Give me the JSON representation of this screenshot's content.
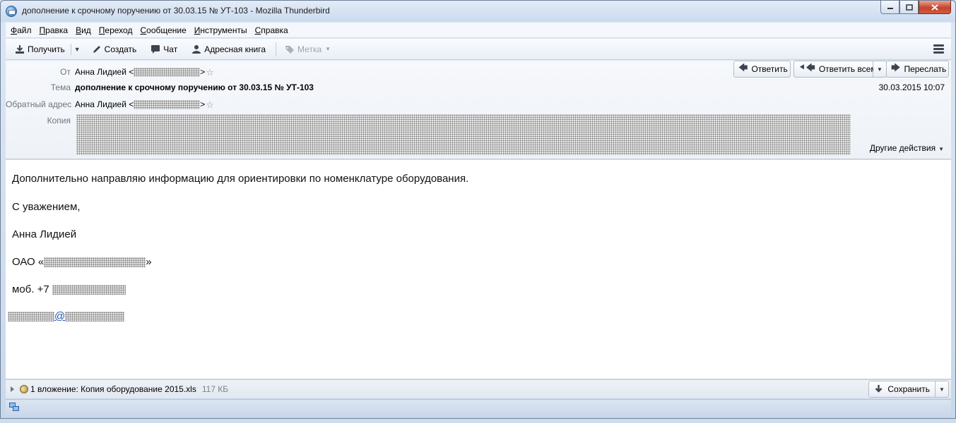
{
  "window": {
    "title": "дополнение к срочному поручению от 30.03.15 № УТ-103 - Mozilla Thunderbird"
  },
  "menu": [
    {
      "accel": "Ф",
      "rest": "айл"
    },
    {
      "accel": "П",
      "rest": "равка"
    },
    {
      "accel": "В",
      "rest": "ид"
    },
    {
      "accel": "П",
      "rest": "ереход"
    },
    {
      "accel": "С",
      "rest": "ообщение"
    },
    {
      "accel": "И",
      "rest": "нструменты"
    },
    {
      "accel": "С",
      "rest": "правка"
    }
  ],
  "toolbar": {
    "get_mail": "Получить",
    "write": "Создать",
    "chat": "Чат",
    "address_book": "Адресная книга",
    "tag": "Метка"
  },
  "header": {
    "from_label": "От",
    "from_name": "Анна Лидией <",
    "from_tail": ">",
    "subject_label": "Тема",
    "subject": "дополнение к срочному поручению от 30.03.15 № УТ-103",
    "reply_to_label": "Обратный адрес",
    "reply_to_name": "Анна Лидией <",
    "reply_to_tail": ">",
    "cc_label": "Копия",
    "date": "30.03.2015 10:07",
    "reply": "Ответить",
    "reply_all": "Ответить всем",
    "forward": "Переслать",
    "other_actions": "Другие действия"
  },
  "body": {
    "line1": "Дополнительно направляю информацию для ориентировки по номенклатуре оборудования.",
    "line2": "С уважением,",
    "line3": "Анна Лидией",
    "company_prefix": "ОАО «",
    "company_suffix": "»",
    "mobile_prefix": "моб. +7",
    "email_at": "@"
  },
  "attachment": {
    "text": "1 вложение: Копия оборудование 2015.xls",
    "size": "117 КБ",
    "save": "Сохранить"
  }
}
